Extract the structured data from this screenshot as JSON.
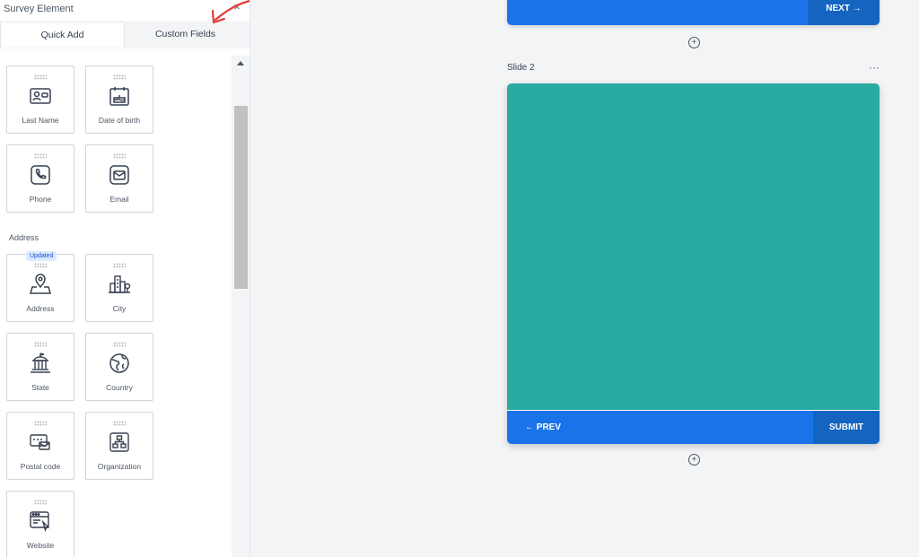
{
  "panel": {
    "title": "Survey Element",
    "close_glyph": "×",
    "tabs": [
      {
        "label": "Quick Add"
      },
      {
        "label": "Custom Fields"
      }
    ],
    "section_address": "Address",
    "updated_badge": "Updated",
    "fields": [
      {
        "label": "Last Name",
        "icon": "id-card-icon"
      },
      {
        "label": "Date of birth",
        "icon": "calendar-cake-icon"
      },
      {
        "label": "Phone",
        "icon": "phone-icon"
      },
      {
        "label": "Email",
        "icon": "mail-icon"
      },
      {
        "label": "Address",
        "icon": "map-pin-icon"
      },
      {
        "label": "City",
        "icon": "city-buildings-icon"
      },
      {
        "label": "State",
        "icon": "capitol-building-icon"
      },
      {
        "label": "Country",
        "icon": "globe-icon"
      },
      {
        "label": "Postal code",
        "icon": "postal-envelope-icon"
      },
      {
        "label": "Organization",
        "icon": "org-chart-icon"
      },
      {
        "label": "Website",
        "icon": "browser-window-icon"
      }
    ]
  },
  "canvas": {
    "next_label": "NEXT →",
    "slide2_label": "Slide 2",
    "more_glyph": "···",
    "add_glyph": "+",
    "prev_label": "← PREV",
    "submit_label": "SUBMIT"
  },
  "colors": {
    "primary": "#1a73e8",
    "primary_dark": "#1565c0",
    "slide_teal": "#2aaba2",
    "annotation_red": "#e53935"
  }
}
